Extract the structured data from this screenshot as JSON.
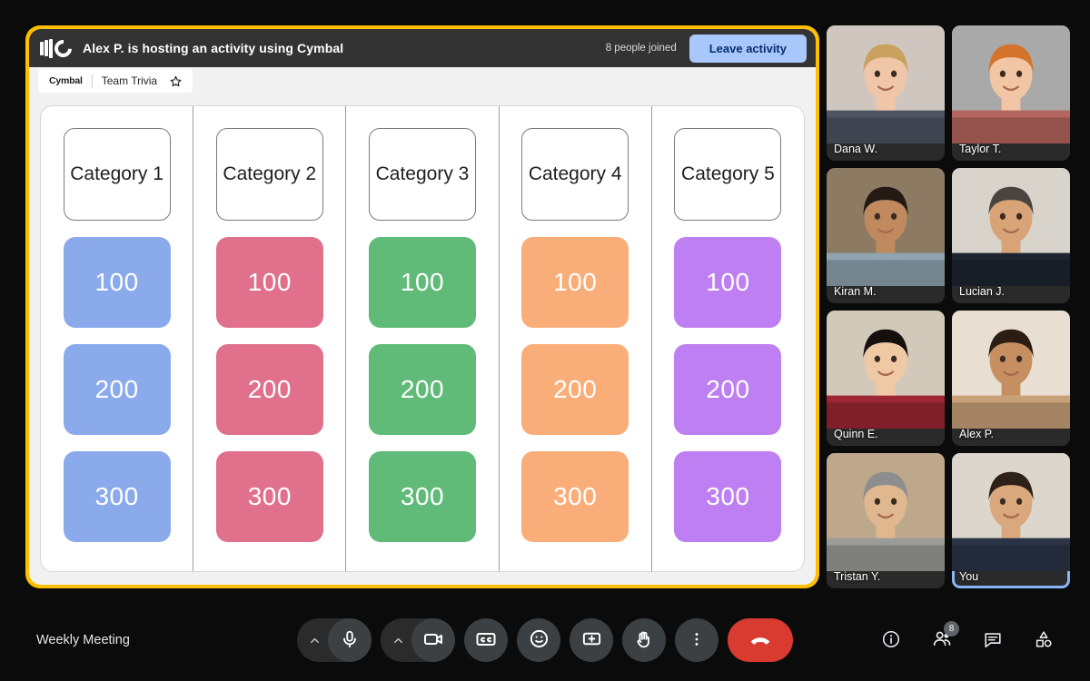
{
  "activity": {
    "logo_icon": "cymbal-logo-icon",
    "host_banner": "Alex P. is hosting an activity using Cymbal",
    "joined_count_label": "8 people joined",
    "leave_button_label": "Leave activity",
    "tab": {
      "brand": "Cymbal",
      "title": "Team Trivia",
      "star_icon": "star-icon"
    },
    "frame_color": "#ffbe00"
  },
  "board": {
    "columns": [
      {
        "category": "Category 1",
        "color": "#8aaaec",
        "values": [
          "100",
          "200",
          "300"
        ]
      },
      {
        "category": "Category 2",
        "color": "#e0708c",
        "values": [
          "100",
          "200",
          "300"
        ]
      },
      {
        "category": "Category 3",
        "color": "#60ba78",
        "values": [
          "100",
          "200",
          "300"
        ]
      },
      {
        "category": "Category 4",
        "color": "#f9ae79",
        "values": [
          "100",
          "200",
          "300"
        ]
      },
      {
        "category": "Category 5",
        "color": "#be7ff2",
        "values": [
          "100",
          "200",
          "300"
        ]
      }
    ]
  },
  "participants": {
    "self_highlight_color": "#8ab4f8",
    "tiles": [
      {
        "name": "Dana W.",
        "self": false,
        "bg": "#cfc7bf",
        "skin": "#f0c6a8",
        "hair": "#c8a15e",
        "shirt": "#4e5562"
      },
      {
        "name": "Taylor T.",
        "self": false,
        "bg": "#a9a9a9",
        "skin": "#f2c6a4",
        "hair": "#d4742c",
        "shirt": "#b5645e"
      },
      {
        "name": "Kiran M.",
        "self": false,
        "bg": "#8c7a63",
        "skin": "#c08a5e",
        "hair": "#231a14",
        "shirt": "#8fa3b0"
      },
      {
        "name": "Lucian J.",
        "self": false,
        "bg": "#d8d4cc",
        "skin": "#d8a477",
        "hair": "#4a4440",
        "shirt": "#1d2530"
      },
      {
        "name": "Quinn E.",
        "self": false,
        "bg": "#d3c9ba",
        "skin": "#eec9a4",
        "hair": "#14100e",
        "shirt": "#9c2733"
      },
      {
        "name": "Alex P.",
        "self": false,
        "bg": "#e9ded2",
        "skin": "#c58f61",
        "hair": "#2b1d14",
        "shirt": "#c8a179"
      },
      {
        "name": "Tristan Y.",
        "self": false,
        "bg": "#bda88c",
        "skin": "#e0b88f",
        "hair": "#8d8d8d",
        "shirt": "#9b9b97"
      },
      {
        "name": "You",
        "self": true,
        "bg": "#dcd6cc",
        "skin": "#d9a87c",
        "hair": "#2d211a",
        "shirt": "#2b3446"
      }
    ]
  },
  "bottom_bar": {
    "meeting_name": "Weekly Meeting",
    "controls": [
      {
        "name": "microphone",
        "icon": "microphone-icon",
        "chevron": true
      },
      {
        "name": "camera",
        "icon": "camera-icon",
        "chevron": true
      },
      {
        "name": "captions",
        "icon": "closed-captions-icon",
        "chevron": false
      },
      {
        "name": "reactions",
        "icon": "emoji-smiley-icon",
        "chevron": false
      },
      {
        "name": "present",
        "icon": "present-screen-icon",
        "chevron": false
      },
      {
        "name": "raise-hand",
        "icon": "raise-hand-icon",
        "chevron": false
      },
      {
        "name": "more-options",
        "icon": "three-dots-icon",
        "chevron": false
      }
    ],
    "hangup": {
      "icon": "phone-hangup-icon",
      "color": "#d93b30"
    },
    "right_controls": [
      {
        "name": "meeting-details",
        "icon": "info-icon",
        "badge": null
      },
      {
        "name": "people",
        "icon": "people-icon",
        "badge": "8"
      },
      {
        "name": "chat",
        "icon": "chat-bubble-icon",
        "badge": null
      },
      {
        "name": "activities",
        "icon": "activities-shapes-icon",
        "badge": null
      }
    ]
  }
}
